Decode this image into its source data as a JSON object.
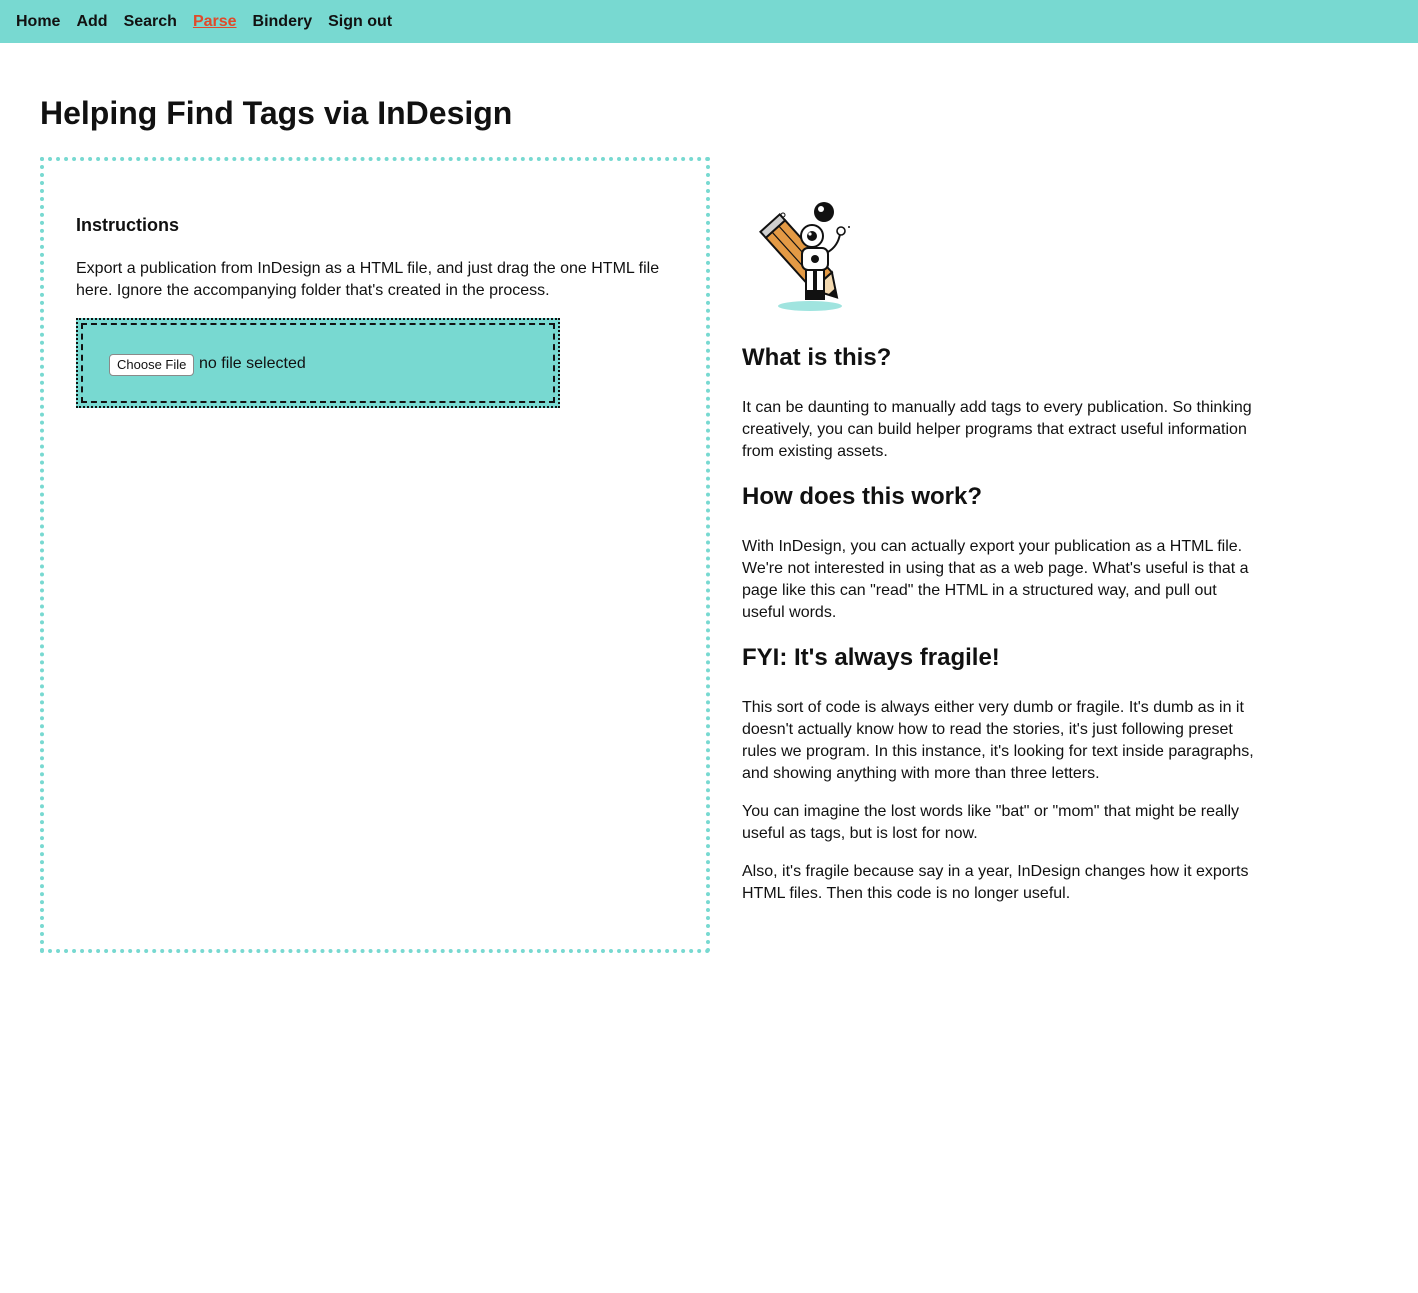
{
  "nav": {
    "items": [
      {
        "label": "Home"
      },
      {
        "label": "Add"
      },
      {
        "label": "Search"
      },
      {
        "label": "Parse",
        "active": true
      },
      {
        "label": "Bindery"
      },
      {
        "label": "Sign out"
      }
    ],
    "accent": "#78d9d1",
    "active_color": "#e04a2a"
  },
  "page": {
    "title": "Helping Find Tags via InDesign"
  },
  "instructions": {
    "title": "Instructions",
    "text": "Export a publication from InDesign as a HTML file, and just drag the one HTML file here. Ignore the accompanying folder that's created in the process."
  },
  "upload": {
    "button_label": "Choose File",
    "status": "no file selected"
  },
  "mascot": {
    "icon": "pencil-robot-mascot-icon"
  },
  "info": {
    "what_title": "What is this?",
    "what_text": "It can be daunting to manually add tags to every publication. So thinking creatively, you can build helper programs that extract useful information from existing assets.",
    "how_title": "How does this work?",
    "how_text": "With InDesign, you can actually export your publication as a HTML file. We're not interested in using that as a web page. What's useful is that a page like this can \"read\" the HTML in a structured way, and pull out useful words.",
    "fyi_title": "FYI: It's always fragile!",
    "fyi_text_1": "This sort of code is always either very dumb or fragile. It's dumb as in it doesn't actually know how to read the stories, it's just following preset rules we program. In this instance, it's looking for text inside paragraphs, and showing anything with more than three letters.",
    "fyi_text_2": "You can imagine the lost words like \"bat\" or \"mom\" that might be really useful as tags, but is lost for now.",
    "fyi_text_3": "Also, it's fragile because say in a year, InDesign changes how it exports HTML files. Then this code is no longer useful."
  }
}
